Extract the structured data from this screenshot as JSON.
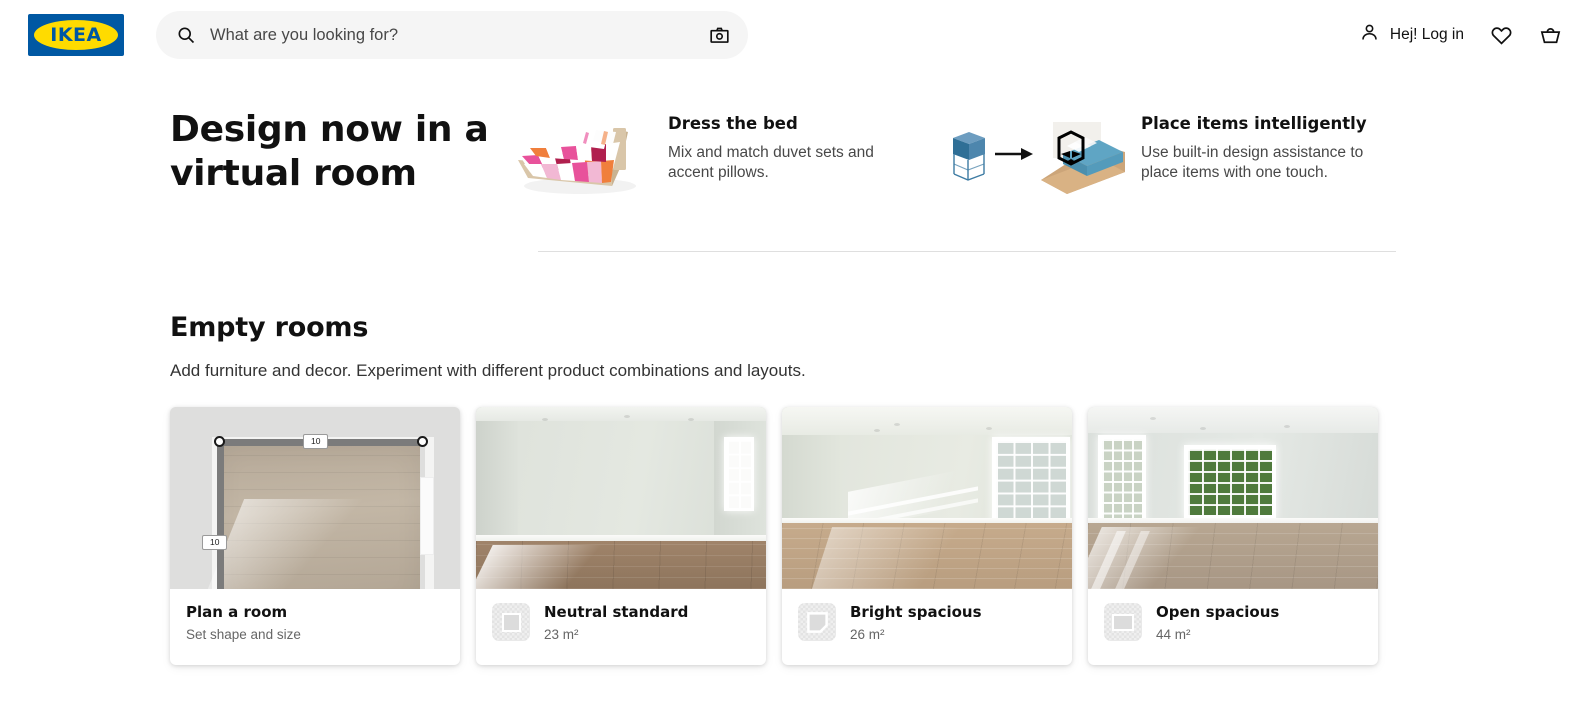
{
  "header": {
    "logo_text": "IKEA",
    "logo_bg": "#0058A3",
    "logo_fg": "#FFDB00",
    "search": {
      "placeholder": "What are you looking for?",
      "value": "",
      "search_icon": "search-icon",
      "camera_icon": "camera-icon"
    },
    "login_label": "Hej! Log in",
    "account_icon": "person-icon",
    "favourites_icon": "heart-icon",
    "cart_icon": "shopping-bag-icon"
  },
  "hero": {
    "title": "Design now in a virtual room",
    "features": [
      {
        "title": "Dress the bed",
        "description": "Mix and match duvet sets and accent pillows.",
        "art": "bed-with-checkered-duvet-illustration"
      },
      {
        "title": "Place items intelligently",
        "description": "Use built-in design assistance to place items with one touch.",
        "art": "nightstand-arrow-to-bedroom-illustration"
      }
    ]
  },
  "section": {
    "title": "Empty rooms",
    "subtitle": "Add furniture and decor. Experiment with different product combinations and layouts.",
    "cards": [
      {
        "label": "Plan a room",
        "meta": "Set shape and size",
        "has_thumb": false,
        "thumb_icon": "",
        "dimension_top": "10",
        "dimension_left": "10",
        "media": "room-floorplan-editor-preview"
      },
      {
        "label": "Neutral standard",
        "meta": "23 m²",
        "has_thumb": true,
        "thumb_icon": "square-room-plan-icon",
        "media": "empty-room-pale-green-with-window"
      },
      {
        "label": "Bright spacious",
        "meta": "26 m²",
        "has_thumb": true,
        "thumb_icon": "angled-room-plan-icon",
        "media": "empty-room-bright-with-french-doors"
      },
      {
        "label": "Open spacious",
        "meta": "44 m²",
        "has_thumb": true,
        "thumb_icon": "wide-room-plan-icon",
        "media": "empty-room-open-with-garden-doors"
      }
    ]
  }
}
